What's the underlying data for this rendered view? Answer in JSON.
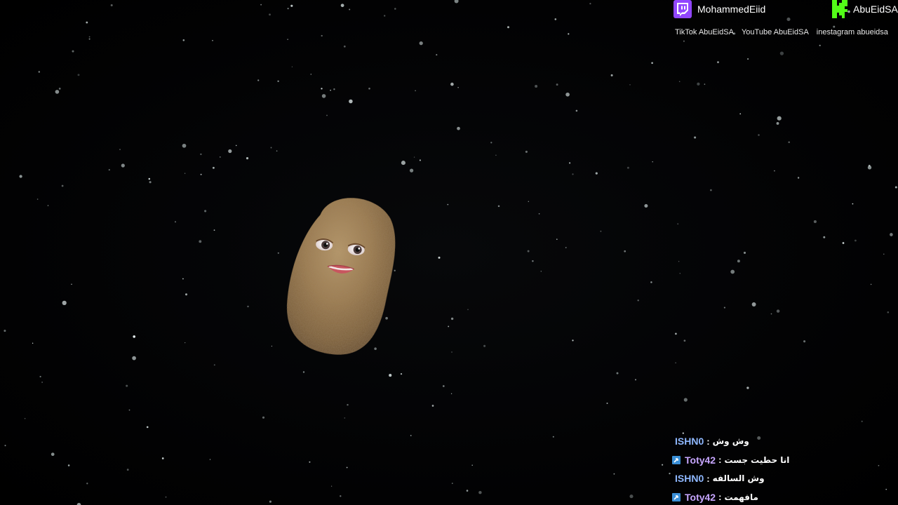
{
  "overlay": {
    "twitch": {
      "icon": "twitch-icon",
      "color": "#9146ff",
      "handle": "MohammedEiid"
    },
    "kick": {
      "icon": "kick-icon",
      "color": "#53fc18",
      "handle": "AbuEidSA"
    },
    "links": [
      "TikTok AbuEidSA",
      "YouTube AbuEidSA",
      "inestagram abueidsa"
    ]
  },
  "chat": {
    "messages": [
      {
        "user": "ISHN0",
        "user_color": "#8fb8ff",
        "message": "وش وش",
        "badge": ""
      },
      {
        "user": "Toty42",
        "user_color": "#c7a6ff",
        "message": "انا حطيت جست",
        "badge": "lightning-badge-icon"
      },
      {
        "user": "ISHN0",
        "user_color": "#8fb8ff",
        "message": "وش السالفه",
        "badge": ""
      },
      {
        "user": "Toty42",
        "user_color": "#c7a6ff",
        "message": "مافهمت",
        "badge": "lightning-badge-icon"
      }
    ],
    "separator": ":"
  },
  "scene": {
    "character": "potato-character",
    "background": "starfield"
  }
}
